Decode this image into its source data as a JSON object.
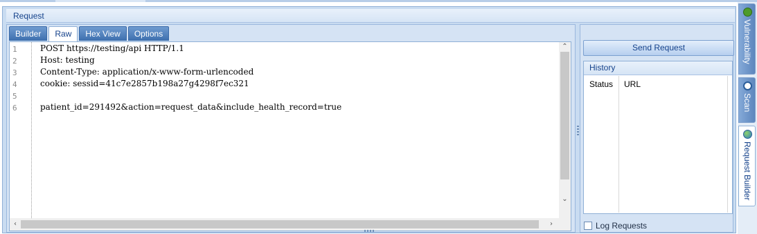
{
  "panel": {
    "title": "Request"
  },
  "tabs": [
    {
      "label": "Builder",
      "active": false
    },
    {
      "label": "Raw",
      "active": true
    },
    {
      "label": "Hex View",
      "active": false
    },
    {
      "label": "Options",
      "active": false
    }
  ],
  "editor": {
    "line_numbers": [
      "1",
      "2",
      "3",
      "4",
      "5",
      "6"
    ],
    "lines": [
      "POST https://testing/api HTTP/1.1",
      "Host: testing",
      "Content-Type: application/x-www-form-urlencoded",
      "cookie: sessid=41c7e2857b198a27g4298f7ec321",
      "",
      "patient_id=291492&action=request_data&include_health_record=true"
    ]
  },
  "send_button": {
    "label": "Send Request"
  },
  "history": {
    "title": "History",
    "columns": [
      "Status",
      "URL"
    ]
  },
  "log_requests": {
    "label": "Log Requests",
    "checked": false
  },
  "sidebar_tabs": [
    {
      "label": "Vulnerability",
      "icon": "bug-icon",
      "active": false
    },
    {
      "label": "Scan",
      "icon": "eye-icon",
      "active": false
    },
    {
      "label": "Request Builder",
      "icon": "globe-icon",
      "active": true
    }
  ],
  "colors": {
    "accent": "#15428b",
    "tab_inactive": "#4f7fbd",
    "panel_bg": "#d5e3f4"
  }
}
